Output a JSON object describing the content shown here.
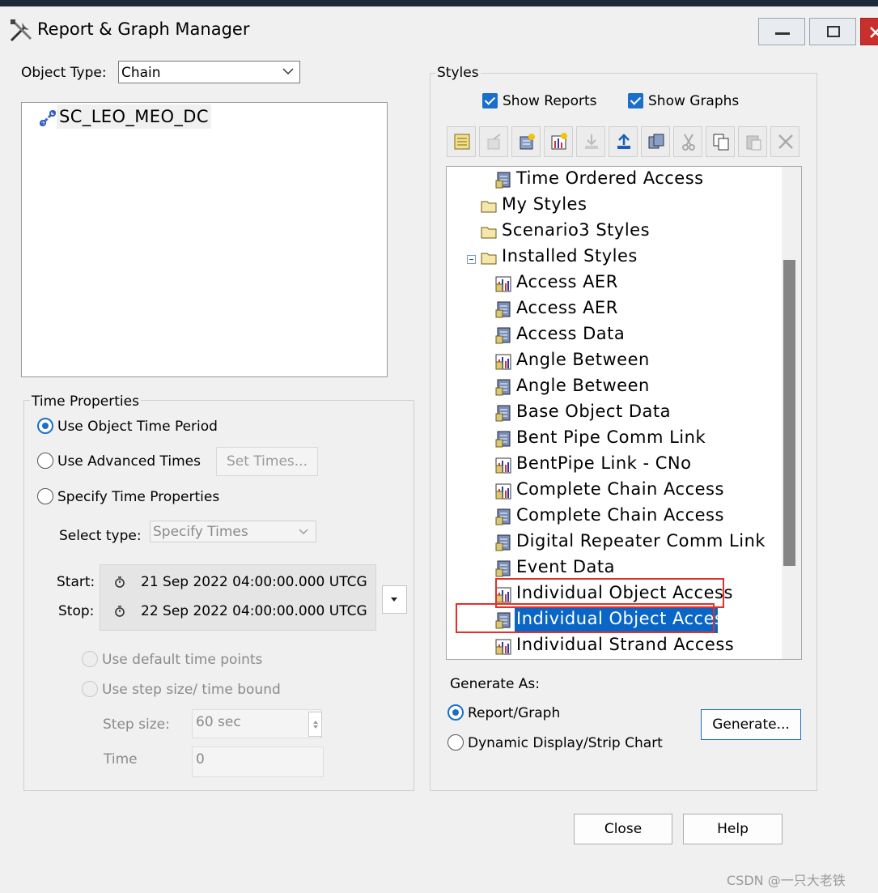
{
  "window": {
    "title": "Report & Graph Manager"
  },
  "object_type": {
    "label": "Object Type:",
    "value": "Chain"
  },
  "object_list": [
    {
      "name": "SC_LEO_MEO_DC",
      "icon": "chain-icon"
    }
  ],
  "time_properties": {
    "group_label": "Time Properties",
    "use_object_time_period": "Use Object Time Period",
    "use_advanced_times": "Use Advanced Times",
    "set_times_button": "Set Times...",
    "specify_time_properties": "Specify Time Properties",
    "select_type_label": "Select type:",
    "select_type_value": "Specify Times",
    "start_label": "Start:",
    "start_value": "21 Sep 2022 04:00:00.000 UTCG",
    "stop_label": "Stop:",
    "stop_value": "22 Sep 2022 04:00:00.000 UTCG",
    "use_default_time_points": "Use default time points",
    "use_step_size": "Use step size/ time bound",
    "step_size_label": "Step size:",
    "step_size_value": "60 sec",
    "time_label": "Time",
    "time_value": "0"
  },
  "styles": {
    "group_label": "Styles",
    "show_reports": "Show Reports",
    "show_graphs": "Show Graphs",
    "toolbar_icons": [
      "report-icon",
      "properties-icon",
      "new-report-icon",
      "new-graph-icon",
      "import-icon",
      "export-icon",
      "duplicate-icon",
      "cut-icon",
      "copy-icon",
      "paste-icon",
      "delete-icon"
    ],
    "tree": [
      {
        "label": "Time Ordered Access",
        "type": "report",
        "indent": 2
      },
      {
        "label": "My Styles",
        "type": "folder",
        "indent": 1
      },
      {
        "label": "Scenario3 Styles",
        "type": "folder",
        "indent": 1
      },
      {
        "label": "Installed Styles",
        "type": "folder",
        "indent": 1,
        "expanded": true
      },
      {
        "label": "Access AER",
        "type": "graph",
        "indent": 2
      },
      {
        "label": "Access AER",
        "type": "report",
        "indent": 2
      },
      {
        "label": "Access Data",
        "type": "report",
        "indent": 2
      },
      {
        "label": "Angle Between",
        "type": "graph",
        "indent": 2
      },
      {
        "label": "Angle Between",
        "type": "report",
        "indent": 2
      },
      {
        "label": "Base Object Data",
        "type": "report",
        "indent": 2
      },
      {
        "label": "Bent Pipe Comm Link",
        "type": "report",
        "indent": 2
      },
      {
        "label": "BentPipe Link - CNo",
        "type": "graph",
        "indent": 2
      },
      {
        "label": "Complete Chain Access",
        "type": "graph",
        "indent": 2
      },
      {
        "label": "Complete Chain Access",
        "type": "report",
        "indent": 2
      },
      {
        "label": "Digital Repeater Comm Link",
        "type": "report",
        "indent": 2
      },
      {
        "label": "Event Data",
        "type": "report",
        "indent": 2
      },
      {
        "label": "Individual Object Access",
        "type": "graph",
        "indent": 2
      },
      {
        "label": "Individual Object Access",
        "type": "report",
        "indent": 2,
        "selected": true
      },
      {
        "label": "Individual Strand Access",
        "type": "graph",
        "indent": 2
      }
    ]
  },
  "generate_as": {
    "label": "Generate As:",
    "report_graph": "Report/Graph",
    "dynamic_display": "Dynamic Display/Strip Chart",
    "generate_button": "Generate..."
  },
  "buttons": {
    "close": "Close",
    "help": "Help"
  },
  "watermark": "CSDN @一只大老铁",
  "colors": {
    "accent": "#1b6fc9",
    "selection": "#0a66c6",
    "highlight_box": "#e0312a",
    "title_close": "#c9302c"
  }
}
